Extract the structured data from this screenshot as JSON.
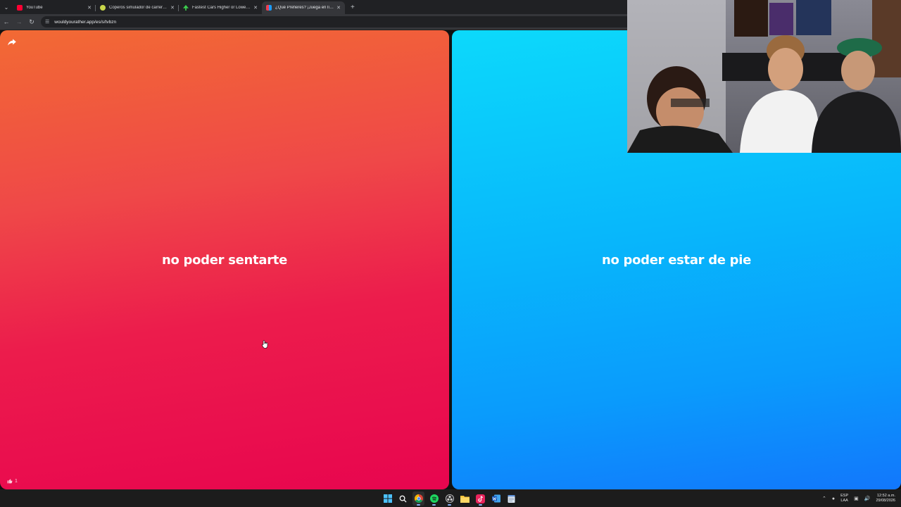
{
  "browser": {
    "tabs": [
      {
        "title": "YouTube",
        "favicon_color": "#ff0033",
        "active": false
      },
      {
        "title": "Coperos simulador de carrera líder",
        "favicon_color": "#c8d64a",
        "active": false
      },
      {
        "title": "Fastest Cars Higher or Lower Game",
        "favicon_color": "#3ccf4e",
        "active": false
      },
      {
        "title": "¿Qué Prefieres? ¡Juega en línea!",
        "favicon_color": "#5b6cff",
        "active": true
      }
    ],
    "new_tab_label": "+",
    "url": "wouldyourather.app/es/s/tvbzn"
  },
  "game": {
    "option_a": "no poder sentarte",
    "option_b": "no poder estar de pie",
    "likes_count": "1",
    "colors": {
      "red_top": "#f26a34",
      "red_bottom": "#e8054f",
      "blue_top": "#0cd9fb",
      "blue_bottom": "#1277fc"
    }
  },
  "taskbar": {
    "apps": [
      "windows-start-icon",
      "search-icon",
      "chrome-icon",
      "spotify-icon",
      "obs-icon",
      "file-explorer-icon",
      "tiktok-icon",
      "word-icon",
      "notepad-icon"
    ],
    "language": "ESP",
    "language_sub": "LAA",
    "time": "12:52 a.m.",
    "date": "29/08/2026"
  }
}
